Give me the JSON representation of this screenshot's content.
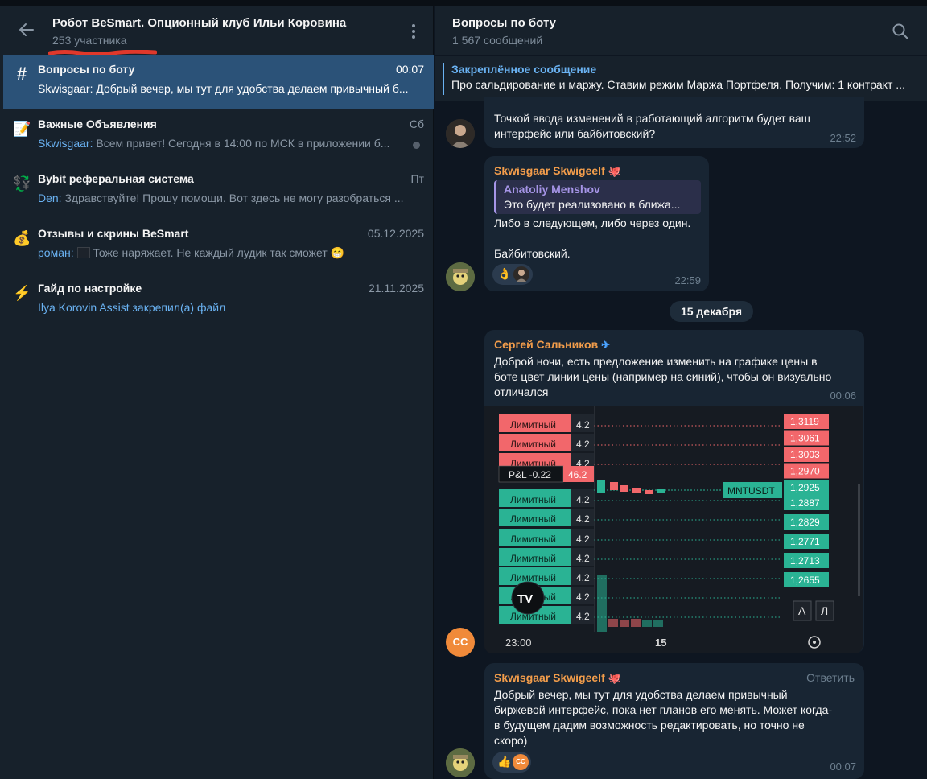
{
  "left": {
    "title": "Робот BeSmart. Опционный клуб Ильи Коровина",
    "subtitle": "253 участника",
    "topics": [
      {
        "icon": "#",
        "title": "Вопросы по боту",
        "time": "00:07",
        "author": "Skwisgaar:",
        "preview": " Добрый вечер, мы тут для удобства делаем привычный б..."
      },
      {
        "icon": "📝",
        "title": "Важные Объявления",
        "time": "Сб",
        "author": "Skwisgaar:",
        "preview": " Всем привет! Сегодня в 14:00 по МСК в приложении б..."
      },
      {
        "icon": "💱",
        "title": "Bybit реферальная система",
        "time": "Пт",
        "author": "Den:",
        "preview": " Здравствуйте! Прошу помощи. Вот здесь не могу разобраться ..."
      },
      {
        "icon": "💰",
        "title": "Отзывы и скрины BeSmart",
        "time": "05.12.2025",
        "author": "роман:",
        "preview": " Тоже наряжает. Не каждый лудик так сможет 😁"
      },
      {
        "icon": "⚡",
        "title": "Гайд по настройке",
        "time": "21.11.2025",
        "author": "Ilya Korovin Assist закрепил(а) файл",
        "preview": ""
      }
    ]
  },
  "chat": {
    "title": "Вопросы по боту",
    "subtitle": "1 567 сообщений",
    "pinned_title": "Закреплённое сообщение",
    "pinned_text": "Про сальдирование и маржу.  Ставим режим Маржа Портфеля. Получим:  1 контракт ...",
    "date_separator": "15 декабря",
    "messages": [
      {
        "line1": "Точкой ввода изменений в работающий алгоритм будет ваш",
        "line2": "интерфейс или байбитовский?",
        "time": "22:52"
      },
      {
        "author": "Skwisgaar Skwigeelf",
        "quote_author": "Anatoliy Menshov",
        "quote_text": "Это будет реализовано в ближа...",
        "line1": "Либо в следующем, либо через один.",
        "line2": "Байбитовский.",
        "reaction": "👌",
        "time": "22:59"
      },
      {
        "author": "Сергей Сальников",
        "line1": "Доброй ночи, есть предложение изменить на графике цены в",
        "line2": "боте цвет линии цены (например на синий), чтобы он визуально",
        "line3": "отличался",
        "time": "00:06",
        "avatar": "СС"
      },
      {
        "author": "Skwisgaar Skwigeelf",
        "reply": "Ответить",
        "line1": "Добрый вечер, мы тут для удобства делаем привычный",
        "line2": "биржевой интерфейс, пока нет планов его менять. Может когда-",
        "line3": "в будущем дадим возможность редактировать, но точно не",
        "line4": "скоро)",
        "reaction": "👍",
        "reaction_avatar": "СС",
        "time": "00:07"
      }
    ]
  },
  "screenshot": {
    "limit_label": "Лимитный",
    "size": "4.2",
    "pnl_label": "P&L -0.22",
    "pnl_value": "46.2",
    "symbol": "MNTUSDT",
    "asks": [
      "1,3119",
      "1,3061",
      "1,3003",
      "1,2970"
    ],
    "current": "1,2925",
    "bids": [
      "1,2887",
      "1,2829",
      "1,2771",
      "1,2713",
      "1,2655"
    ],
    "x_labels": [
      "23:00",
      "15"
    ],
    "btn_a": "А",
    "btn_l": "Л",
    "logo": "TV"
  }
}
